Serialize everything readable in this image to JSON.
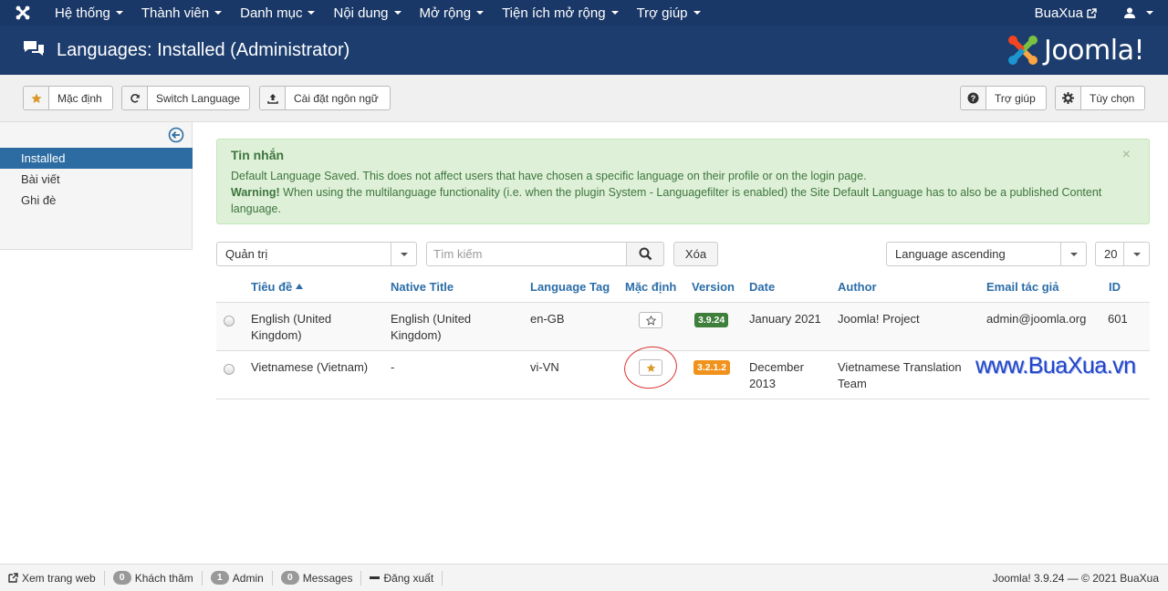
{
  "navbar": {
    "menu": [
      "Hệ thống",
      "Thành viên",
      "Danh mục",
      "Nội dung",
      "Mở rộng",
      "Tiện ích mở rộng",
      "Trợ giúp"
    ],
    "user": "BuaXua"
  },
  "header": {
    "title": "Languages: Installed (Administrator)",
    "brand": "Joomla!"
  },
  "toolbar": {
    "default_label": "Mặc định",
    "switch_label": "Switch Language",
    "install_label": "Cài đặt ngôn ngữ",
    "help_label": "Trợ giúp",
    "options_label": "Tùy chọn"
  },
  "sidebar": {
    "items": [
      "Installed",
      "Bài viết",
      "Ghi đè"
    ]
  },
  "alert": {
    "title": "Tin nhắn",
    "line1": "Default Language Saved. This does not affect users that have chosen a specific language on their profile or on the login page.",
    "warning_label": "Warning!",
    "warning_text": " When using the multilanguage functionality (i.e. when the plugin System - Languagefilter is enabled) the Site Default Language has to also be a published Content language.",
    "close": "×"
  },
  "filters": {
    "client": "Quản trị",
    "search_placeholder": "Tìm kiếm",
    "clear_label": "Xóa",
    "ordering": "Language ascending",
    "limit": "20"
  },
  "table": {
    "headers": {
      "title": "Tiêu đề",
      "native": "Native Title",
      "tag": "Language Tag",
      "default": "Mặc định",
      "version": "Version",
      "date": "Date",
      "author": "Author",
      "email": "Email tác giả",
      "id": "ID"
    },
    "rows": [
      {
        "title_1": "English (United",
        "title_2": "Kingdom)",
        "native_1": "English (United",
        "native_2": "Kingdom)",
        "tag": "en-GB",
        "version": "3.9.24",
        "version_color": "#3e7f3c",
        "date_1": "January 2021",
        "date_2": "",
        "author_1": "Joomla! Project",
        "author_2": "",
        "email": "admin@joomla.org",
        "id": "601"
      },
      {
        "title_1": "Vietnamese (Vietnam)",
        "title_2": "",
        "native_1": "-",
        "native_2": "",
        "tag": "vi-VN",
        "version": "3.2.1.2",
        "version_color": "#f0921b",
        "date_1": "December",
        "date_2": "2013",
        "author_1": "Vietnamese Translation",
        "author_2": "Team",
        "email": "",
        "id": ""
      }
    ]
  },
  "watermark": "www.BuaXua.vn",
  "statusbar": {
    "view_site": "Xem trang web",
    "visitors_count": "0",
    "visitors_label": "Khách thăm",
    "admin_count": "1",
    "admin_label": "Admin",
    "messages_count": "0",
    "messages_label": "Messages",
    "logout": "Đăng xuất",
    "footer": "Joomla! 3.9.24  —  © 2021 BuaXua"
  },
  "colors": {
    "navbar": "#1a3867",
    "header": "#1c3d6e",
    "accent": "#2d6ca2",
    "success_bg": "#dff0d8",
    "star": "#d89a2b"
  }
}
